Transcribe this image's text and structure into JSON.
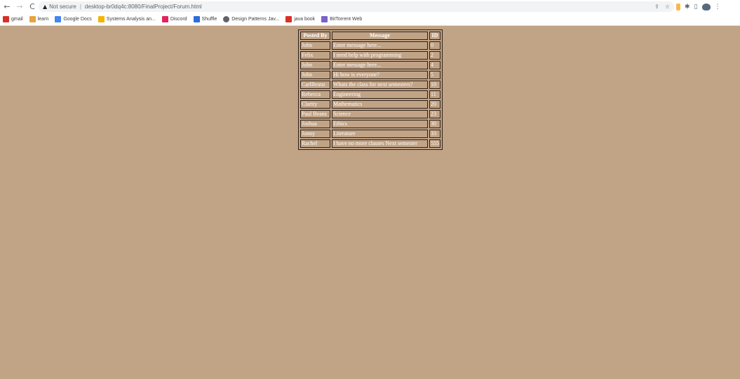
{
  "browser": {
    "security_label": "Not secure",
    "url": "desktop-br0dq4c:8080/FinalProject/Forum.html"
  },
  "bookmarks": [
    {
      "label": "gmail",
      "icon": "gmail-icon",
      "color": "#d93025"
    },
    {
      "label": "learn",
      "icon": "learn-icon",
      "color": "#e8a33d"
    },
    {
      "label": "Google Docs",
      "icon": "docs-icon",
      "color": "#4285f4"
    },
    {
      "label": "Systems Analysis an...",
      "icon": "systems-icon",
      "color": "#f4b400"
    },
    {
      "label": "Discord",
      "icon": "discord-icon",
      "color": "#e0245e"
    },
    {
      "label": "Shuffle",
      "icon": "shuffle-icon",
      "color": "#2b6cde"
    },
    {
      "label": "Design Patterns Jav...",
      "icon": "globe-icon",
      "color": "#5f6368"
    },
    {
      "label": "java book",
      "icon": "java-book-icon",
      "color": "#d93025"
    },
    {
      "label": "BitTorrent Web",
      "icon": "bittorrent-icon",
      "color": "#7b61c9"
    }
  ],
  "forum": {
    "headers": [
      "Posted By",
      "Message",
      "ID"
    ],
    "rows": [
      [
        "John",
        "Enter message here...",
        "0"
      ],
      [
        "Felix",
        "I need help with programming",
        "2"
      ],
      [
        "John",
        "Enter message here...",
        "4"
      ],
      [
        "John",
        "Hi how is everyone?",
        "5"
      ],
      [
        "CarlBeanz",
        "Whats the class for next semesters?",
        "10"
      ],
      [
        "Rebecca",
        "Engineering",
        "11"
      ],
      [
        "Clarity",
        "Mathematics",
        "20"
      ],
      [
        "Paul Beans",
        "Science",
        "23"
      ],
      [
        "Joshua",
        "Ethics",
        "30"
      ],
      [
        "Jonny",
        "Literature",
        "33"
      ],
      [
        "Rachel",
        "I have no more classes Next semester",
        "555"
      ]
    ]
  },
  "colors": {
    "page_background": "#c1a386",
    "table_border": "#2d2017",
    "text": "#ffffff"
  }
}
